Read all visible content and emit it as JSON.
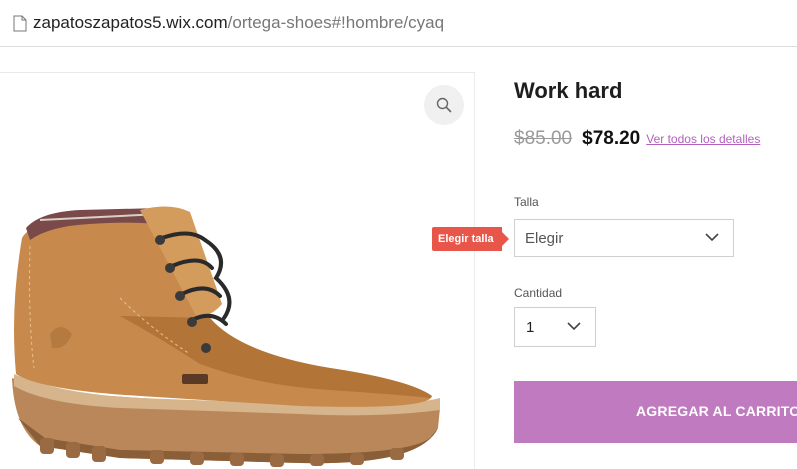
{
  "address_bar": {
    "host": "zapatoszapatos5.wix.com",
    "path": "/ortega-shoes#!hombre/cyaq"
  },
  "gallery": {
    "zoom_icon": "magnifier-icon",
    "image_alt": "brown leather work boot"
  },
  "product": {
    "title": "Work hard",
    "old_price": "$85.00",
    "price": "$78.20",
    "details_link": "Ver todos los detalles"
  },
  "options": {
    "size_label": "Talla",
    "size_value": "Elegir",
    "size_tooltip": "Elegir talla",
    "quantity_label": "Cantidad",
    "quantity_value": "1"
  },
  "cart": {
    "button_label": "AGREGAR AL CARRITO"
  },
  "colors": {
    "accent": "#c07bc0",
    "link": "#b45fbe",
    "tooltip": "#e8564a"
  }
}
